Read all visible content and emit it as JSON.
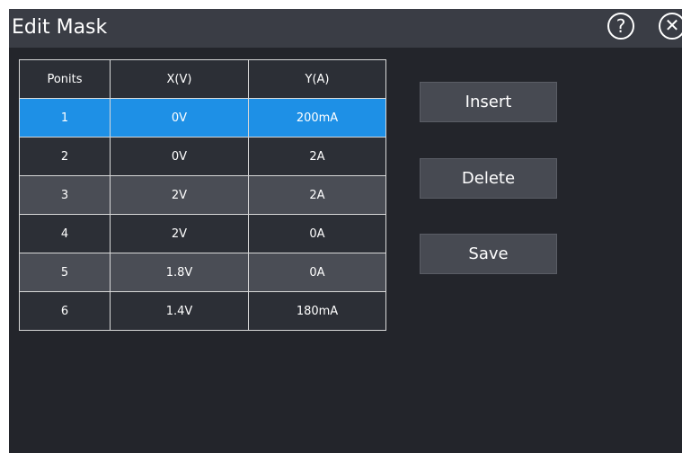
{
  "dialog": {
    "title": "Edit Mask",
    "help_glyph": "?",
    "close_glyph": "✕"
  },
  "table": {
    "headers": [
      "Ponits",
      "X(V)",
      "Y(A)"
    ],
    "rows": [
      {
        "point": "1",
        "x": "0V",
        "y": "200mA"
      },
      {
        "point": "2",
        "x": "0V",
        "y": "2A"
      },
      {
        "point": "3",
        "x": "2V",
        "y": "2A"
      },
      {
        "point": "4",
        "x": "2V",
        "y": "0A"
      },
      {
        "point": "5",
        "x": "1.8V",
        "y": "0A"
      },
      {
        "point": "6",
        "x": "1.4V",
        "y": "180mA"
      }
    ],
    "selected_row": "1"
  },
  "buttons": {
    "insert": "Insert",
    "delete": "Delete",
    "save": "Save"
  },
  "colors": {
    "background": "#23252b",
    "titlebar": "#3a3d45",
    "selected": "#1e90e6",
    "row_light": "#4a4d55",
    "row_dark": "#2c2f36",
    "button": "#474a52"
  },
  "icons": [
    "help-icon",
    "close-icon"
  ]
}
